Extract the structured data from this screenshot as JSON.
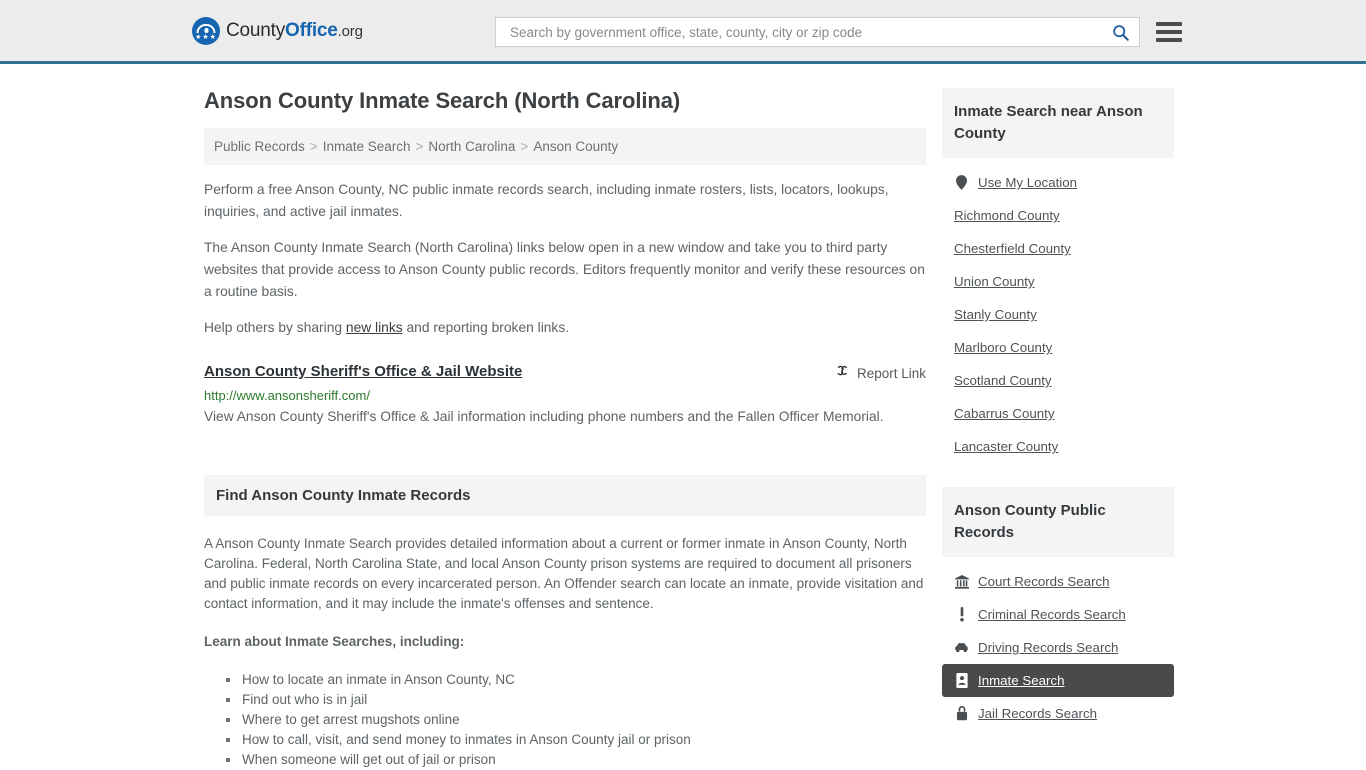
{
  "header": {
    "logo": {
      "part1": "County",
      "part2": "Office",
      "part3": ".org",
      "stars": "★★★"
    },
    "search": {
      "placeholder": "Search by government office, state, county, city or zip code",
      "value": "",
      "icon": "search-icon"
    },
    "menu_icon": "hamburger-menu-icon",
    "accent_color": "#31708f",
    "background_color": "#ececec"
  },
  "main": {
    "title": "Anson County Inmate Search (North Carolina)",
    "breadcrumb": [
      {
        "label": "Public Records"
      },
      {
        "label": "Inmate Search"
      },
      {
        "label": "North Carolina"
      },
      {
        "label": "Anson County"
      }
    ],
    "breadcrumb_separator": ">",
    "intro_paragraph": "Perform a free Anson County, NC public inmate records search, including inmate rosters, lists, locators, lookups, inquiries, and active jail inmates.",
    "disclaimer_paragraph": "The Anson County Inmate Search (North Carolina) links below open in a new window and take you to third party websites that provide access to Anson County public records. Editors frequently monitor and verify these resources on a routine basis.",
    "share_prefix": "Help others by sharing ",
    "share_link": "new links",
    "share_suffix": " and reporting broken links.",
    "result": {
      "title": "Anson County Sheriff's Office & Jail Website",
      "url": "http://www.ansonsheriff.com/",
      "description": "View Anson County Sheriff's Office & Jail information including phone numbers and the Fallen Officer Memorial.",
      "report_label": "Report Link",
      "report_icon": "broken-link-icon",
      "url_color": "#2c7a2c"
    },
    "section": {
      "heading": "Find Anson County Inmate Records",
      "paragraph": "A Anson County Inmate Search provides detailed information about a current or former inmate in Anson County, North Carolina. Federal, North Carolina State, and local Anson County prison systems are required to document all prisoners and public inmate records on every incarcerated person. An Offender search can locate an inmate, provide visitation and contact information, and it may include the inmate's offenses and sentence.",
      "learn_heading": "Learn about Inmate Searches, including:",
      "bullets": [
        "How to locate an inmate in Anson County, NC",
        "Find out who is in jail",
        "Where to get arrest mugshots online",
        "How to call, visit, and send money to inmates in Anson County jail or prison",
        "When someone will get out of jail or prison"
      ]
    }
  },
  "sidebar": {
    "nearby": {
      "heading": "Inmate Search near Anson County",
      "items": [
        {
          "label": "Use My Location",
          "icon": "map-pin-icon",
          "active": false
        },
        {
          "label": "Richmond County",
          "icon": "",
          "active": false
        },
        {
          "label": "Chesterfield County",
          "icon": "",
          "active": false
        },
        {
          "label": "Union County",
          "icon": "",
          "active": false
        },
        {
          "label": "Stanly County",
          "icon": "",
          "active": false
        },
        {
          "label": "Marlboro County",
          "icon": "",
          "active": false
        },
        {
          "label": "Scotland County",
          "icon": "",
          "active": false
        },
        {
          "label": "Cabarrus County",
          "icon": "",
          "active": false
        },
        {
          "label": "Lancaster County",
          "icon": "",
          "active": false
        }
      ]
    },
    "public_records": {
      "heading": "Anson County Public Records",
      "items": [
        {
          "label": "Court Records Search",
          "icon": "courthouse-icon",
          "active": false
        },
        {
          "label": "Criminal Records Search",
          "icon": "exclamation-icon",
          "active": false
        },
        {
          "label": "Driving Records Search",
          "icon": "car-icon",
          "active": false
        },
        {
          "label": "Inmate Search",
          "icon": "id-badge-icon",
          "active": true
        },
        {
          "label": "Jail Records Search",
          "icon": "lock-icon",
          "active": false
        }
      ],
      "active_background": "#4a4a4a"
    }
  }
}
